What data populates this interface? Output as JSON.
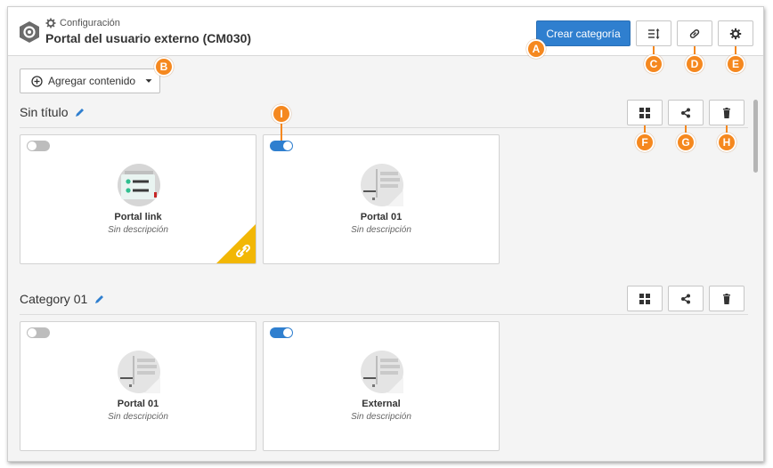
{
  "header": {
    "breadcrumb": "Configuración",
    "title": "Portal del usuario externo (CM030)",
    "create_category_label": "Crear categoría"
  },
  "toolbar": {
    "add_content_label": "Agregar contenido"
  },
  "sections": [
    {
      "title": "Sin título",
      "cards": [
        {
          "title": "Portal link",
          "description": "Sin descripción",
          "enabled": false
        },
        {
          "title": "Portal 01",
          "description": "Sin descripción",
          "enabled": true
        }
      ]
    },
    {
      "title": "Category 01",
      "cards": [
        {
          "title": "Portal 01",
          "description": "Sin descripción",
          "enabled": false
        },
        {
          "title": "External",
          "description": "Sin descripción",
          "enabled": true
        }
      ]
    }
  ],
  "callouts": {
    "A": "A",
    "B": "B",
    "C": "C",
    "D": "D",
    "E": "E",
    "F": "F",
    "G": "G",
    "H": "H",
    "I": "I"
  },
  "colors": {
    "primary": "#2f7fcf",
    "callout": "#f5881f",
    "link_badge": "#f2b705"
  },
  "icons": [
    "gear-icon",
    "sort-icon",
    "link-icon",
    "settings-icon",
    "plus-circle-icon",
    "caret-down-icon",
    "edit-icon",
    "grid-icon",
    "share-icon",
    "trash-icon"
  ]
}
